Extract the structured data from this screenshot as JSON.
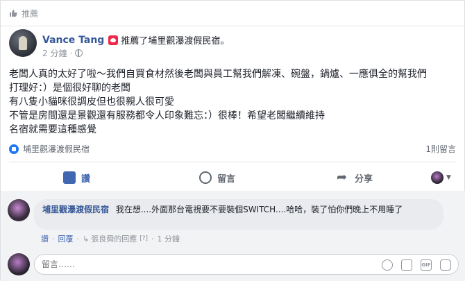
{
  "header": {
    "label": "推薦"
  },
  "post": {
    "author": "Vance Tang",
    "action": "推薦了埔里觀瀑渡假民宿。",
    "time": "2 分鐘",
    "text_lines": [
      "老闆人真的太好了啦～我們自買食材然後老闆與員工幫我們解凍、碗盤，鍋爐、一應俱全的幫我們",
      "打理好：）是個很好聊的老闆",
      "有八隻小貓咪很調皮但也很親人很可愛",
      "不管是房間還是景觀還有服務都令人印象難忘：）很棒！希望老闆繼續維持",
      "名宿就需要這種感覺"
    ],
    "place": "埔里觀瀑渡假民宿",
    "comment_count": "1則留言"
  },
  "actions": {
    "like": "讚",
    "comment": "留言",
    "share": "分享"
  },
  "comment": {
    "author": "埔里觀瀑渡假民宿",
    "text": "我在想....外面那台電視要不要裝個SWITCH....哈哈，裝了怕你們晚上不用睡了",
    "like": "讚",
    "reply": "回覆",
    "reply_by": "張良舜的回應",
    "edit_mark": "[?]",
    "time": "1 分鐘"
  },
  "composer": {
    "placeholder": "留言……"
  },
  "icons": {
    "header": "thumbs-up-icon",
    "recommend": "recommend-heart-icon",
    "privacy": "globe-icon",
    "place": "like-badge-icon",
    "composer": [
      "emoji-icon",
      "camera-icon",
      "gif-icon",
      "sticker-icon"
    ]
  },
  "colors": {
    "link": "#365899",
    "accent": "#4267b2",
    "recommend": "#f02849"
  }
}
